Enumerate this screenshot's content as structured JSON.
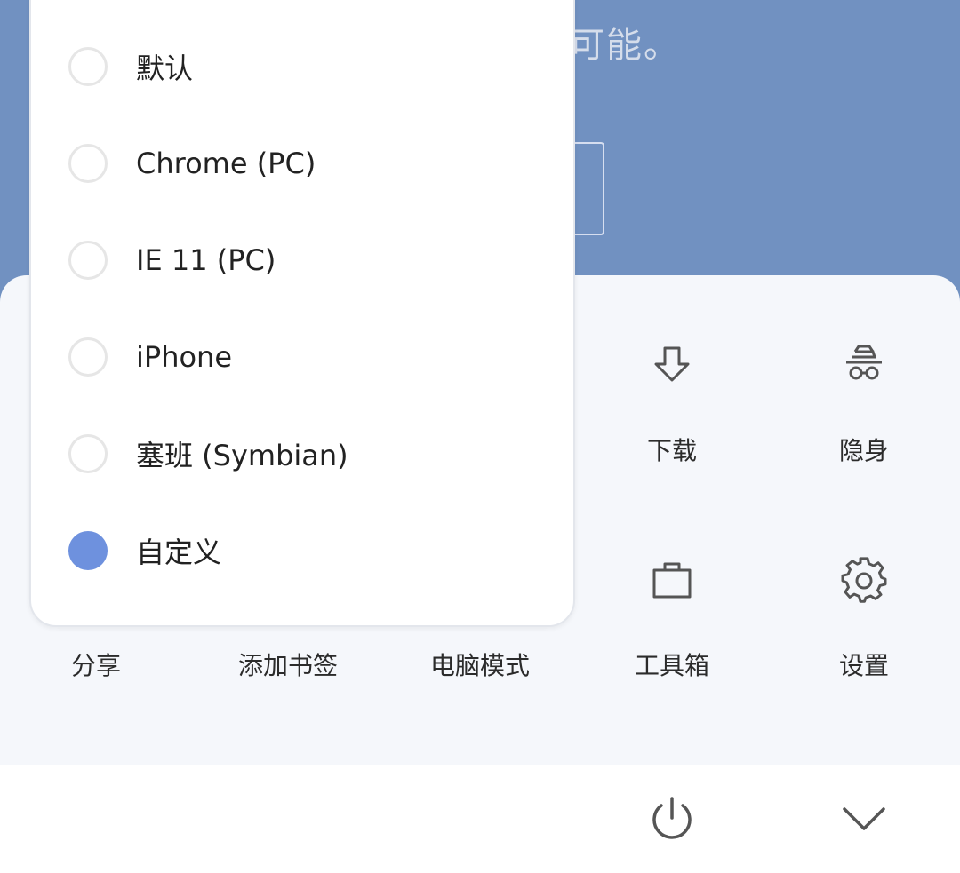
{
  "background": {
    "partial_text": "可能。"
  },
  "ua_menu": {
    "options": [
      {
        "label": "默认",
        "selected": false
      },
      {
        "label": "Chrome (PC)",
        "selected": false
      },
      {
        "label": "IE 11 (PC)",
        "selected": false
      },
      {
        "label": "iPhone",
        "selected": false
      },
      {
        "label": "塞班 (Symbian)",
        "selected": false
      },
      {
        "label": "自定义",
        "selected": true
      }
    ],
    "selected_color": "#6e91de"
  },
  "menu": {
    "row1": [
      {
        "label": "下载",
        "icon": "download-icon"
      },
      {
        "label": "隐身",
        "icon": "incognito-icon"
      }
    ],
    "row2": [
      {
        "label": "分享",
        "icon": "share-icon"
      },
      {
        "label": "添加书签",
        "icon": "bookmark-add-icon"
      },
      {
        "label": "电脑模式",
        "icon": "desktop-mode-icon"
      },
      {
        "label": "工具箱",
        "icon": "toolbox-icon"
      },
      {
        "label": "设置",
        "icon": "gear-icon"
      }
    ]
  },
  "bottom_bar": {
    "power_icon": "power-icon",
    "collapse_icon": "chevron-down-icon"
  },
  "colors": {
    "header_blue": "#7191c1",
    "sheet_bg": "#f5f7fb"
  }
}
